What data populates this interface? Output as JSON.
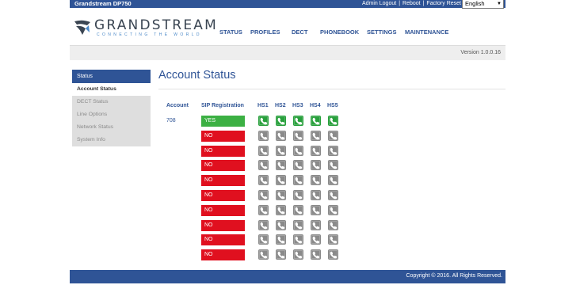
{
  "header": {
    "product": "Grandstream DP750",
    "links": [
      "Admin Logout",
      "Reboot",
      "Factory Reset"
    ],
    "language": "English"
  },
  "logo": {
    "name": "GRANDSTREAM",
    "tagline": "CONNECTING THE WORLD"
  },
  "nav": [
    "STATUS",
    "PROFILES",
    "DECT",
    "PHONEBOOK",
    "SETTINGS",
    "MAINTENANCE"
  ],
  "version": "Version 1.0.0.16",
  "sidebar": {
    "header": "Status",
    "items": [
      {
        "label": "Account Status",
        "active": true
      },
      {
        "label": "DECT Status",
        "active": false
      },
      {
        "label": "Line Options",
        "active": false
      },
      {
        "label": "Network Status",
        "active": false
      },
      {
        "label": "System Info",
        "active": false
      }
    ]
  },
  "page": {
    "title": "Account Status"
  },
  "table": {
    "headers": {
      "account": "Account",
      "sip": "SIP Registration",
      "handsets": [
        "HS1",
        "HS2",
        "HS3",
        "HS4",
        "HS5"
      ]
    },
    "rows": [
      {
        "account": "708",
        "sip": "YES",
        "handsets": [
          true,
          true,
          true,
          true,
          true
        ]
      },
      {
        "account": "",
        "sip": "NO",
        "handsets": [
          false,
          false,
          false,
          false,
          false
        ]
      },
      {
        "account": "",
        "sip": "NO",
        "handsets": [
          false,
          false,
          false,
          false,
          false
        ]
      },
      {
        "account": "",
        "sip": "NO",
        "handsets": [
          false,
          false,
          false,
          false,
          false
        ]
      },
      {
        "account": "",
        "sip": "NO",
        "handsets": [
          false,
          false,
          false,
          false,
          false
        ]
      },
      {
        "account": "",
        "sip": "NO",
        "handsets": [
          false,
          false,
          false,
          false,
          false
        ]
      },
      {
        "account": "",
        "sip": "NO",
        "handsets": [
          false,
          false,
          false,
          false,
          false
        ]
      },
      {
        "account": "",
        "sip": "NO",
        "handsets": [
          false,
          false,
          false,
          false,
          false
        ]
      },
      {
        "account": "",
        "sip": "NO",
        "handsets": [
          false,
          false,
          false,
          false,
          false
        ]
      },
      {
        "account": "",
        "sip": "NO",
        "handsets": [
          false,
          false,
          false,
          false,
          false
        ]
      }
    ]
  },
  "footer": {
    "copyright": "Copyright © 2016. All Rights Reserved."
  },
  "colors": {
    "brand": "#2f5496",
    "yes": "#3cb043",
    "no": "#e0101f",
    "handset_on": "#28a03c",
    "handset_off": "#8a8a8a"
  },
  "icons": {
    "handset": "phone-handset-icon"
  }
}
